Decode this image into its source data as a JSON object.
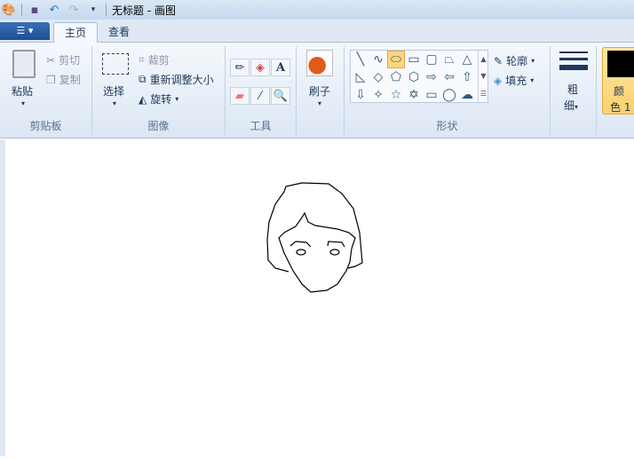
{
  "title": "无标题 - 画图",
  "tabs": [
    {
      "label": "主页"
    },
    {
      "label": "查看"
    }
  ],
  "clipboard": {
    "paste": "粘贴",
    "cut": "剪切",
    "copy": "复制",
    "label": "剪贴板"
  },
  "image": {
    "select": "选择",
    "crop": "裁剪",
    "resize": "重新调整大小",
    "rotate": "旋转",
    "label": "图像"
  },
  "tools": {
    "label": "工具"
  },
  "brushes": {
    "label": "刷子"
  },
  "shapes": {
    "label": "形状",
    "outline": "轮廓",
    "fill": "填充",
    "selected": "oval"
  },
  "size": {
    "label1": "粗",
    "label2": "细"
  },
  "color1": {
    "label1": "颜",
    "label2": "色 1",
    "value": "#000000"
  }
}
